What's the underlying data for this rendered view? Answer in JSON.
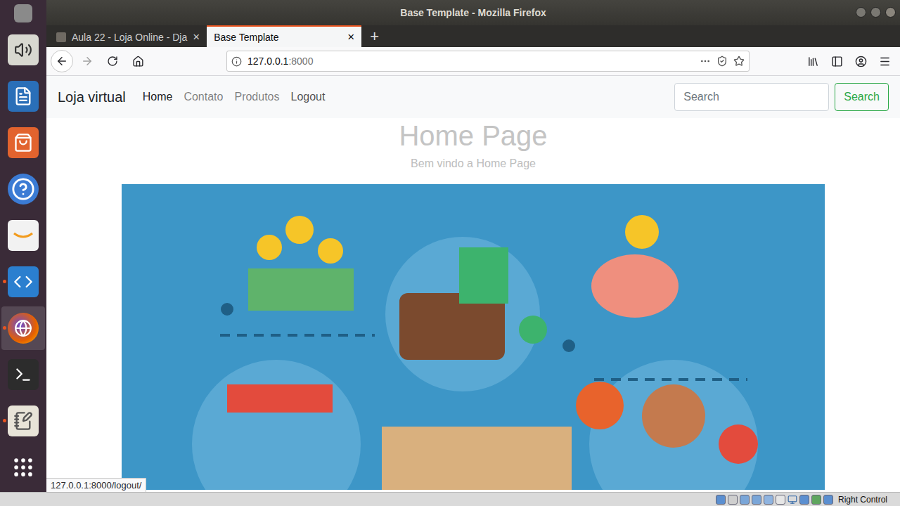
{
  "window": {
    "title": "Base Template - Mozilla Firefox"
  },
  "dock": [
    {
      "kind": "top",
      "running": false,
      "focused": false
    },
    {
      "kind": "audio",
      "running": false,
      "focused": false
    },
    {
      "kind": "writer",
      "running": false,
      "focused": false
    },
    {
      "kind": "software",
      "running": false,
      "focused": false
    },
    {
      "kind": "help",
      "running": false,
      "focused": false
    },
    {
      "kind": "amazon",
      "running": false,
      "focused": false
    },
    {
      "kind": "vscode",
      "running": true,
      "focused": false
    },
    {
      "kind": "firefox",
      "running": true,
      "focused": true
    },
    {
      "kind": "terminal",
      "running": false,
      "focused": false
    },
    {
      "kind": "editor",
      "running": true,
      "focused": false
    },
    {
      "kind": "apps",
      "running": false,
      "focused": false
    }
  ],
  "tabs": [
    {
      "label": "Aula 22 - Loja Online - Dja",
      "selected": false,
      "close": "×"
    },
    {
      "label": "Base Template",
      "selected": true,
      "close": "×"
    }
  ],
  "new_tab": "+",
  "address": {
    "host": "127.0.0.1",
    "port": ":8000"
  },
  "page": {
    "brand": "Loja virtual",
    "links": [
      {
        "label": "Home",
        "selected": true,
        "hovered": false
      },
      {
        "label": "Contato",
        "selected": false,
        "hovered": false
      },
      {
        "label": "Produtos",
        "selected": false,
        "hovered": false
      },
      {
        "label": "Logout",
        "selected": false,
        "hovered": true
      }
    ],
    "search": {
      "placeholder": "Search",
      "button": "Search"
    },
    "heading": "Home Page",
    "subtitle": "Bem vindo a Home Page"
  },
  "status_link": "127.0.0.1:8000/logout/",
  "vm_status": {
    "key": "Right Control"
  }
}
